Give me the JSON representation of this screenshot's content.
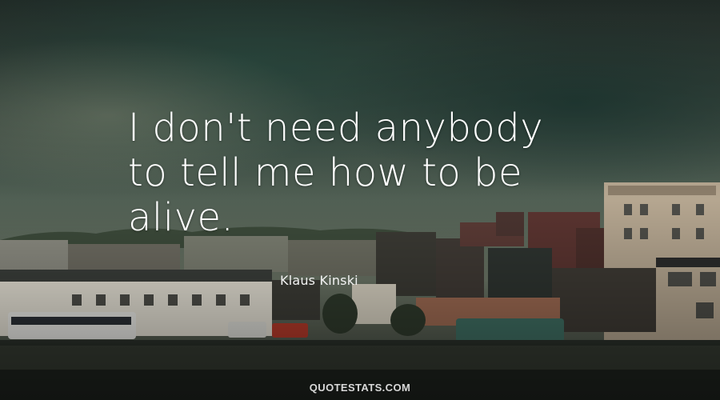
{
  "quote": {
    "lines": [
      "I don't need anybody",
      "to tell me how to be",
      "alive."
    ]
  },
  "author": "Klaus Kinski",
  "footer": "QUOTESTATS.COM",
  "colors": {
    "sky_top": "#2c3a35",
    "cloud_green": "#2f5146",
    "haze": "#5f6d5c",
    "building_shadow": "#242b26",
    "text": "#ffffff"
  }
}
